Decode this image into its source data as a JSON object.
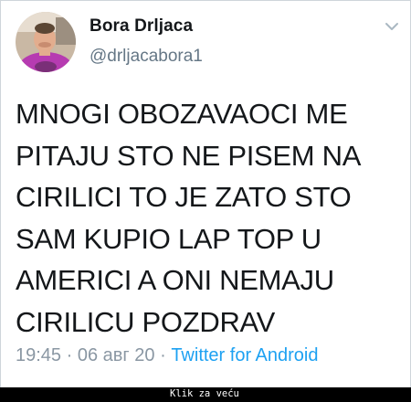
{
  "tweet": {
    "display_name": "Bora Drljaca",
    "handle": "@drljacabora1",
    "text_lines": [
      "MNOGI OBOZAVAOCI ME",
      "PITAJU STO NE PISEM NA",
      "CIRILICI TO JE ZATO STO",
      "SAM KUPIO LAP TOP U",
      "AMERICI A ONI NEMAJU",
      "CIRILICU POZDRAV"
    ],
    "time": "19:45",
    "date": "06 авг 20",
    "separator": "·",
    "source": "Twitter for Android",
    "menu_icon": "chevron-down-icon",
    "avatar_icon": "profile-photo"
  },
  "footer": {
    "link_text": "Klik za veću"
  },
  "colors": {
    "text": "#14171a",
    "secondary": "#657786",
    "link": "#1da1f2",
    "background": "#ffffff",
    "frame": "#000000"
  }
}
